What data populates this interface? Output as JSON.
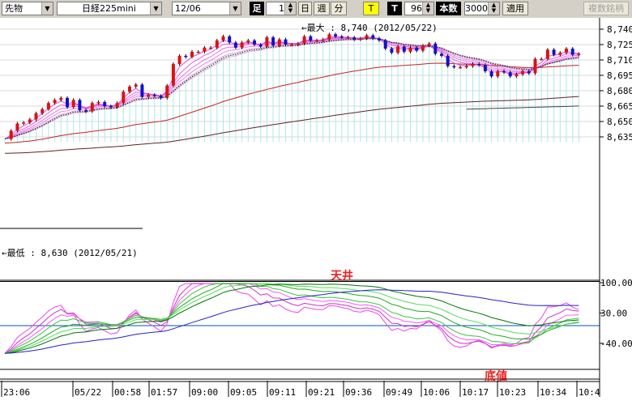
{
  "toolbar": {
    "type_select": "先物",
    "symbol_select": "日経225mini",
    "date_select": "12/06",
    "ashi_label": "足",
    "interval_value": "1",
    "day_button": "日",
    "week_button": "週",
    "month_button": "分",
    "tick_button": "T",
    "t_label": "T",
    "t_value": "96",
    "count_label": "本数",
    "count_value": "3000",
    "apply_button": "適用",
    "compare_button": "複数銘柄"
  },
  "colors": {
    "up": "#dd1111",
    "down": "#1111cc",
    "cloud": "#aee8e8",
    "ma_green": "#004400",
    "ma_red": "#cc2222",
    "ma_brown": "#662222",
    "guppy": "#dd44dd"
  },
  "chart_data": [
    {
      "type": "candlestick",
      "y_ticks": [
        "8,740",
        "8,725",
        "8,710",
        "8,695",
        "8,680",
        "8,665",
        "8,650",
        "8,635"
      ],
      "ylim": [
        8629,
        8745
      ],
      "x_ticks": [
        "23:06",
        "05/22",
        "00:58",
        "01:57",
        "09:00",
        "09:05",
        "09:11",
        "09:21",
        "09:36",
        "09:49",
        "10:06",
        "10:17",
        "10:23",
        "10:34",
        "10:4"
      ],
      "annotations": {
        "high": "←最大 : 8,740 (2012/05/22)",
        "low": "←最低 : 8,630 (2012/05/21)"
      },
      "closes": [
        8633,
        8641,
        8648,
        8649,
        8652,
        8658,
        8662,
        8668,
        8671,
        8673,
        8664,
        8671,
        8661,
        8660,
        8668,
        8669,
        8665,
        8664,
        8668,
        8679,
        8684,
        8686,
        8674,
        8676,
        8675,
        8673,
        8685,
        8706,
        8714,
        8713,
        8718,
        8718,
        8722,
        8722,
        8729,
        8733,
        8727,
        8722,
        8727,
        8729,
        8725,
        8723,
        8732,
        8724,
        8730,
        8725,
        8725,
        8726,
        8733,
        8729,
        8729,
        8730,
        8735,
        8733,
        8732,
        8732,
        8730,
        8731,
        8734,
        8731,
        8729,
        8721,
        8717,
        8723,
        8718,
        8722,
        8719,
        8724,
        8726,
        8716,
        8714,
        8704,
        8703,
        8703,
        8704,
        8706,
        8705,
        8699,
        8694,
        8699,
        8698,
        8694,
        8696,
        8699,
        8697,
        8711,
        8711,
        8720,
        8715,
        8717,
        8721,
        8715,
        8716
      ]
    },
    {
      "type": "line",
      "y_ticks": [
        "100.00",
        "30.00",
        "-40.00"
      ],
      "ylim": [
        -100,
        100
      ],
      "annotations": {
        "top": "天井",
        "bottom": "底値"
      }
    }
  ]
}
